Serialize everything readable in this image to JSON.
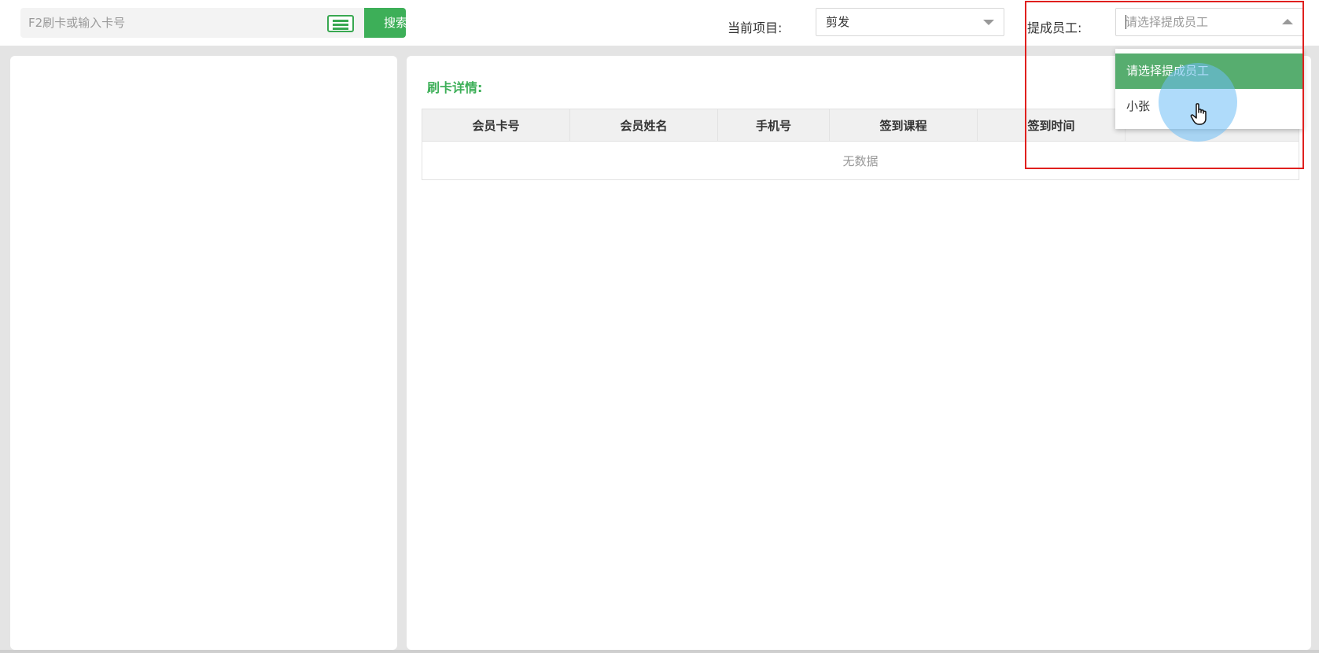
{
  "search": {
    "placeholder": "F2刷卡或输入卡号",
    "button_label": "搜索"
  },
  "project": {
    "label": "当前项目:",
    "value": "剪发"
  },
  "staff": {
    "label": "提成员工:",
    "placeholder": "请选择提成员工",
    "options": [
      "请选择提成员工",
      "小张"
    ]
  },
  "details": {
    "title": "刷卡详情:",
    "columns": [
      "会员卡号",
      "会员姓名",
      "手机号",
      "签到课程",
      "签到时间"
    ],
    "empty_text": "无数据"
  },
  "colors": {
    "accent": "#3daf58",
    "highlight": "#e0201e",
    "dropdown_selected": "#57ad6f"
  }
}
